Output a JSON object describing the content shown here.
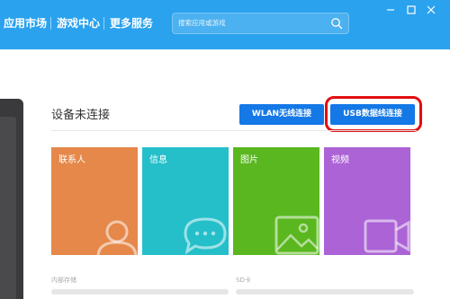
{
  "nav": {
    "items": [
      "应用市场",
      "游戏中心",
      "更多服务"
    ]
  },
  "search": {
    "placeholder": "搜索应用或游戏"
  },
  "window_controls": [
    "minimize-icon",
    "maximize-icon",
    "close-icon"
  ],
  "connection": {
    "title": "设备未连接",
    "wlan_button": "WLAN无线连接",
    "usb_button": "USB数据线连接"
  },
  "tiles": [
    {
      "label": "联系人",
      "icon": "contact-icon",
      "color": "#e5884a"
    },
    {
      "label": "信息",
      "icon": "message-icon",
      "color": "#25bfc9"
    },
    {
      "label": "图片",
      "icon": "picture-icon",
      "color": "#5ab71f"
    },
    {
      "label": "视频",
      "icon": "video-icon",
      "color": "#ab63d6"
    }
  ],
  "storage": {
    "internal_label": "内部存储",
    "sd_label": "SD卡"
  },
  "colors": {
    "topbar": "#2aa2ee",
    "button": "#1478e6",
    "highlight": "#e10e10"
  }
}
